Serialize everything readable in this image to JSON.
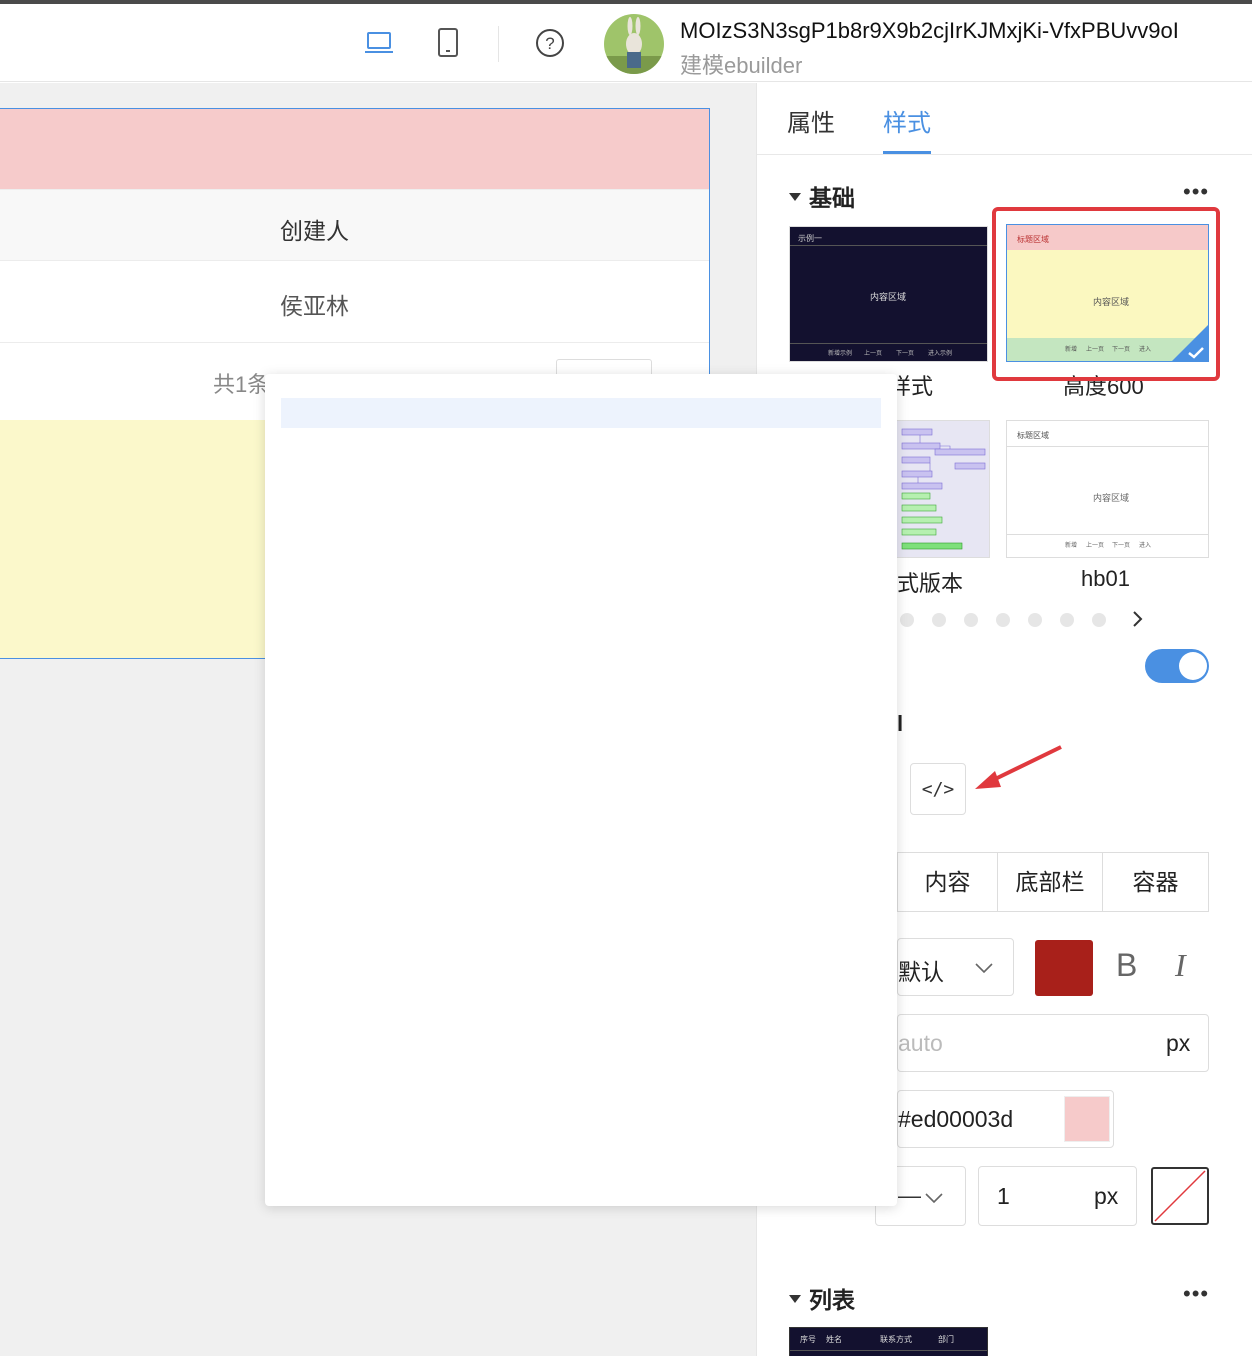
{
  "header": {
    "user_name": "MOIzS3N3sgP1b8r9X9b2cjIrKJMxjKi-VfxPBUvv9oI",
    "user_sub": "建模ebuilder",
    "accent": "#4a90e2"
  },
  "canvas": {
    "table_header": "创建人",
    "table_row": "侯亚林",
    "pager_total": "共1条",
    "colors": {
      "title_bg": "#f6cbcb",
      "content_bg": "#fbf8cb"
    }
  },
  "panel": {
    "tabs": [
      {
        "label": "属性"
      },
      {
        "label": "样式"
      }
    ],
    "active_tab": "样式",
    "sections": {
      "basic": "基础",
      "list": "列表"
    },
    "more_icon": "more-horizontal-icon",
    "templates": [
      {
        "label": "样式",
        "preview": {
          "header": "示例一",
          "content": "内容区域",
          "footer": [
            "新增示例",
            "上一页",
            "下一页",
            "进入示例"
          ]
        }
      },
      {
        "label": "高度600",
        "preview": {
          "header": "标题区域",
          "content": "内容区域",
          "footer": [
            "新增",
            "上一页",
            "下一页",
            "进入"
          ]
        },
        "selected": true
      },
      {
        "label": "式版本"
      },
      {
        "label": "hb01",
        "preview": {
          "header": "标题区域",
          "content": "内容区域",
          "footer": [
            "新增",
            "上一页",
            "下一页",
            "进入"
          ]
        }
      }
    ],
    "toggle_on": true,
    "partial_label": "l",
    "code_icon": "</>",
    "segments": [
      "内容",
      "底部栏",
      "容器"
    ],
    "font": {
      "family": "默认",
      "color": "#a8201a",
      "bold": "B",
      "italic": "I"
    },
    "height": {
      "value": "auto",
      "unit": "px"
    },
    "bg_color": {
      "value": "#ed00003d",
      "swatch": "#f6caca"
    },
    "border": {
      "style": "—",
      "width": "1",
      "unit": "px"
    },
    "list_preview_headers": [
      "序号",
      "姓名",
      "联系方式",
      "部门"
    ]
  }
}
